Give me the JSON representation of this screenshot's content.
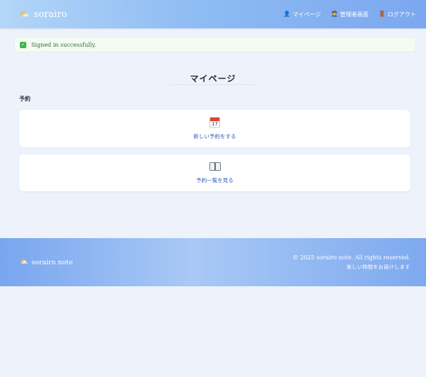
{
  "header": {
    "brand": "sorairo",
    "brand_icon": "sun-behind-cloud-icon",
    "nav": [
      {
        "label": "マイページ",
        "icon": "person-icon"
      },
      {
        "label": "管理者画面",
        "icon": "admin-person-icon"
      },
      {
        "label": "ログアウト",
        "icon": "door-icon"
      }
    ]
  },
  "flash": {
    "message": "Signed in successfully.",
    "icon": "check-icon",
    "color": "#3fb14a"
  },
  "main": {
    "title": "マイページ",
    "section_label": "予約",
    "cards": [
      {
        "icon": "calendar-icon",
        "calendar_day": "17",
        "label": "新しい予約をする"
      },
      {
        "icon": "book-icon",
        "label": "予約一覧を見る"
      }
    ]
  },
  "footer": {
    "brand": "sorairo note",
    "brand_icon": "sun-behind-cloud-icon",
    "copyright": "© 2025 sorairo note. All rights reserved.",
    "tagline": "楽しい時間をお届けします"
  },
  "colors": {
    "header_gradient_start": "#b3d6f8",
    "header_gradient_end": "#7ba7ef",
    "link": "#2f62b8",
    "background": "#eef3fb"
  }
}
